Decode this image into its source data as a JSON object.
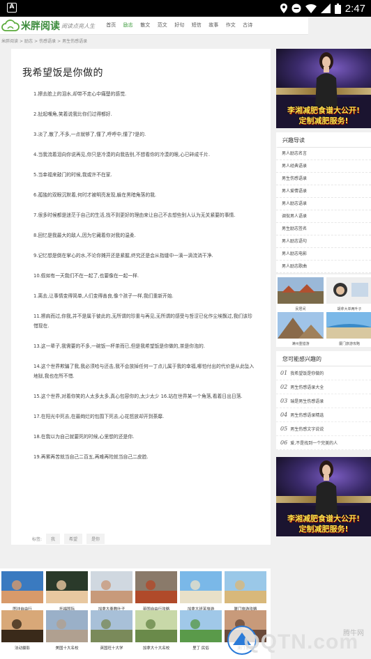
{
  "status_bar": {
    "app_badge": "A",
    "time": "2:47"
  },
  "site": {
    "name": "米胖阅读",
    "slogan": "阅读点亮人生"
  },
  "nav": [
    "首页",
    "励志",
    "散文",
    "范文",
    "好句",
    "短信",
    "故事",
    "作文",
    "古诗"
  ],
  "nav_active": "励志",
  "breadcrumb": [
    "米胖阅读",
    ">",
    "励志",
    ">",
    "伤感语录",
    ">",
    "男生伤感语录"
  ],
  "article": {
    "title": "我希望饭是你做的",
    "paragraphs": [
      "1.擦去脸上的泪水,却带不走心中痛楚的感觉.",
      "2.扯起嘴角,笑着说我比你们过得都好.",
      "3.淡了,散了,不多,一点就够了,懂了,呼呼中,懂了?是的.",
      "4.当我流着泪向你说再见,你只是冷漠的向我告别,不想看你的冷漠的眼,心已碎成千片.",
      "5.当幸福来敲门的时候,我或许不在家.",
      "6.孤独的双眼沉默着,何时才被明亮发现,躲在黑暗角落的我.",
      "7.很多时候都是迷茫于自己的生活,找不到更好的理由来让自己不去想些别人认为无关紧要的事情.",
      "8.回忆是我最大的敌人,因为它藏着你对我的温柔.",
      "9.记忆想是倒在掌心的水,不论你摊开还是紧握,终究还是会从指缝中一滴一滴流淌干净.",
      "10.假如有一天我们不在一起了,也要像在一起一样.",
      "1.离去,让事情变得简单,人们变得善良,像个孩子一样,我们重新开始.",
      "11.擦肩而过,你我,并不是属于彼此的,无所谓的珍重与再见,无所谓的感受与哲涩已化作尘埃飘过,我们该珍惜现在.",
      "13.这一辈子,我需要的不多,一碗饭一杯茶而已,但是我希望饭是你做的,茶是你泡的.",
      "14.这个世界欺骗了我,我必须哈与还击,我不会放掉任何一丁点儿属于我的幸福,哪怕付出的代价是从此坠入地狱,我也在所不惜.",
      "15.这个世界,对着你笑的人太多太多,真心包容你的,太少太少 16.站在世界某一个角落,看着日出日落.",
      "17.在阳光中死去,在最绚烂的包围下死去,心花怒放却开到荼靡.",
      "18.在我以为自己就要死的时候,心里想的还是你.",
      "19.再累再苦就当自己二百五,再难再险就当自己二皮脸."
    ],
    "tags_label": "标签:",
    "tags": [
      "我",
      "希望",
      "是你"
    ]
  },
  "ad": {
    "line1": "李湘减肥食谱大公开!",
    "line2": "定制减肥服务!"
  },
  "sidebar_guide": {
    "title": "兴趣导读",
    "items": [
      "男人励志名言",
      "男人经典语录",
      "男生伤感语录",
      "男人爱情语录",
      "男人励志语录",
      "调侃男人语录",
      "男生励志签名",
      "男人励志语句",
      "男人励志电影",
      "男人励志歌曲"
    ]
  },
  "sidebar_photos": [
    "民居间",
    "胡拿大单两叶子",
    "满州重猎游",
    "厦门旅游攻略"
  ],
  "sidebar_interest": {
    "title": "您可能感兴趣的",
    "items": [
      {
        "num": "01",
        "text": "我希望饭是你做的"
      },
      {
        "num": "02",
        "text": "男生伤感语录大全"
      },
      {
        "num": "03",
        "text": "瑞是男生伤感语录"
      },
      {
        "num": "04",
        "text": "男生伤感语录精选"
      },
      {
        "num": "05",
        "text": "男生伤感文字说说"
      },
      {
        "num": "06",
        "text": "爱,不是找到一个完美的人"
      }
    ]
  },
  "bottom_row1": [
    "图冲自由行",
    "托福国际",
    "加拿大奉教叶子",
    "英国自由行攻略",
    "加拿大班芙旅游",
    "厦门旅游攻略"
  ],
  "bottom_row2": [
    "法动摄影",
    "美国十大名校",
    "英国旺十大学",
    "加拿大十大名校",
    "里丁 民俗",
    "澳门 游乐"
  ],
  "watermark": {
    "small": "腾牛网",
    "big": "QQTN.com"
  }
}
